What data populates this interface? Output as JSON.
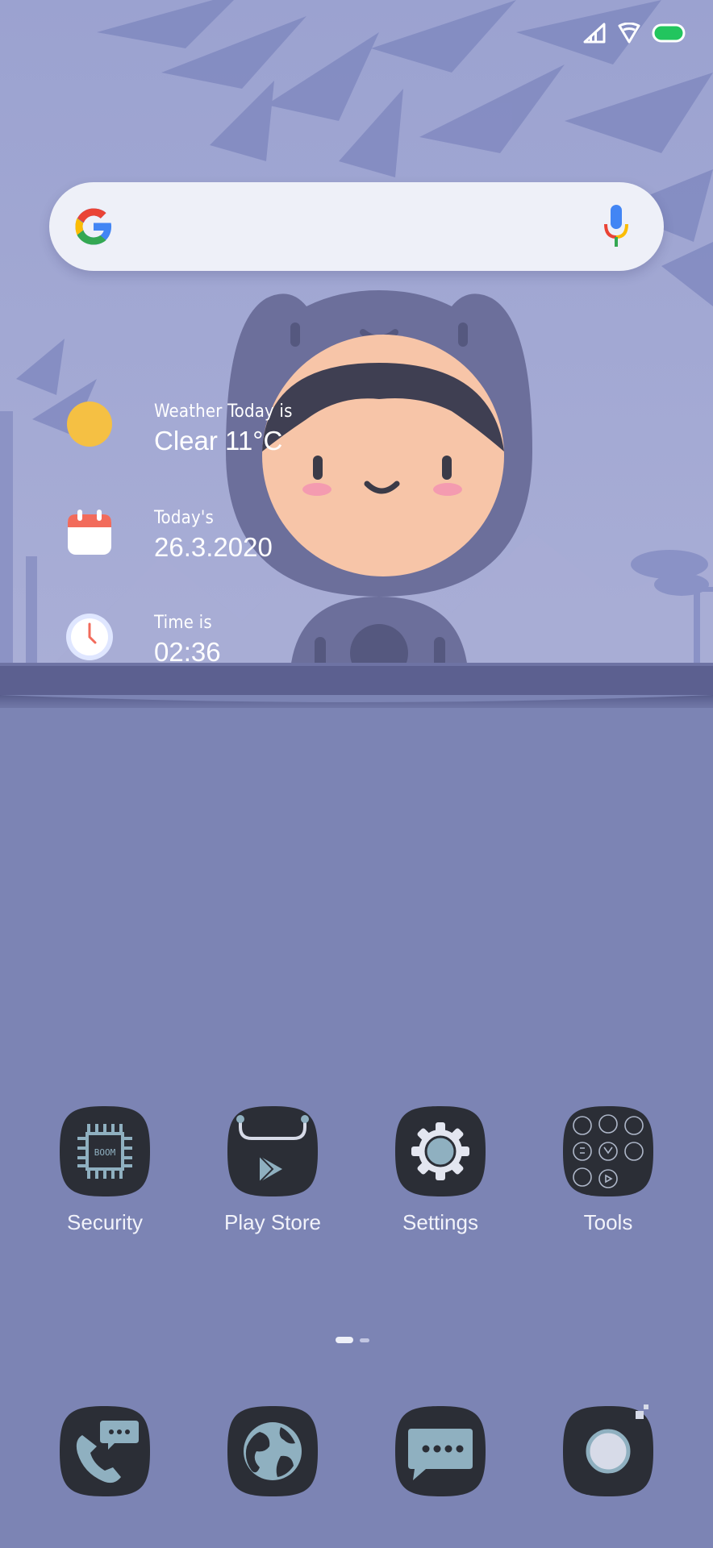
{
  "theme": {
    "background": "#7c84b4",
    "wallpaper_top": "#9aa1cf",
    "shelf": "#5c6090",
    "tile": "#2b2e36",
    "tile_accent": "#8fb0c0"
  },
  "status_bar": {
    "icons": [
      "signal-icon",
      "wifi-icon",
      "battery-icon"
    ]
  },
  "search_bar": {
    "logo": "google-logo-icon",
    "mic": "microphone-icon"
  },
  "widgets": {
    "weather": {
      "caption": "Weather Today is",
      "value": "Clear  11°C",
      "icon": "sun-icon"
    },
    "date": {
      "caption": "Today's",
      "value": "26.3.2020",
      "icon": "calendar-icon"
    },
    "time": {
      "caption": "Time is",
      "value": "02:36",
      "icon": "clock-icon"
    }
  },
  "apps": [
    {
      "label": "Security",
      "icon": "chip-icon",
      "chip_text": "BOOM"
    },
    {
      "label": "Play Store",
      "icon": "play-store-bag-icon"
    },
    {
      "label": "Settings",
      "icon": "gear-icon"
    },
    {
      "label": "Tools",
      "icon": "folder-icon"
    }
  ],
  "page_indicator": {
    "pages": 2,
    "current": 1
  },
  "dock": [
    "phone-icon",
    "browser-globe-icon",
    "messages-icon",
    "camera-icon"
  ]
}
